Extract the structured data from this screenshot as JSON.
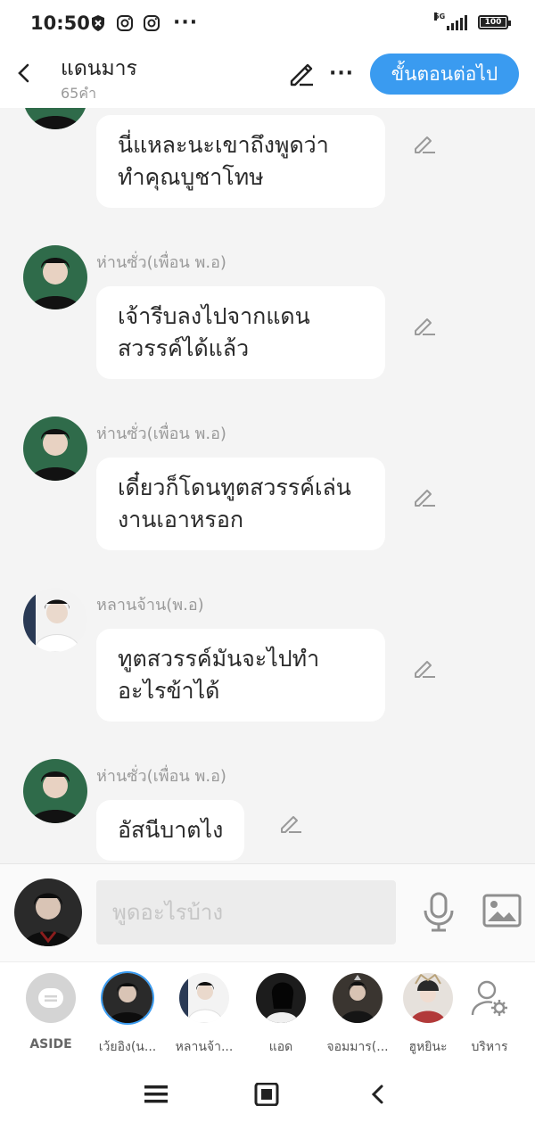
{
  "status_bar": {
    "time": "10:50",
    "network": "5G",
    "battery": "100"
  },
  "header": {
    "title": "แดนมาร",
    "word_count": "65คำ",
    "next_label": "ขั้นตอนต่อไป"
  },
  "messages": [
    {
      "speaker": "",
      "text": "นี่แหละนะเขาถึงพูดว่า\nทำคุณบูชาโทษ",
      "avatar": "dark-haired-man-green"
    },
    {
      "speaker": "ห่านซั่ว(เพื่อน พ.อ)",
      "text": "เจ้ารีบลงไปจากแดน\nสวรรค์ได้แล้ว",
      "avatar": "dark-haired-man-green"
    },
    {
      "speaker": "ห่านซั่ว(เพื่อน พ.อ)",
      "text": "เดี๋ยวก็โดนทูตสวรรค์เล่น\nงานเอาหรอก",
      "avatar": "dark-haired-man-green"
    },
    {
      "speaker": "หลานจ้าน(พ.อ)",
      "text": "ทูตสวรรค์มันจะไปทำ\nอะไรข้าได้",
      "avatar": "man-white-robes"
    },
    {
      "speaker": "ห่านซั่ว(เพื่อน พ.อ)",
      "text": "อัสนีบาตไง",
      "avatar": "dark-haired-man-green"
    }
  ],
  "composer": {
    "placeholder": "พูดอะไรบ้าง"
  },
  "characters": [
    {
      "name": "ASIDE",
      "icon": "aside-icon"
    },
    {
      "name": "เว้ยอิง(น...",
      "icon": "avatar"
    },
    {
      "name": "หลานจ้า...",
      "icon": "avatar"
    },
    {
      "name": "แอด",
      "icon": "avatar"
    },
    {
      "name": "จอมมาร(...",
      "icon": "avatar"
    },
    {
      "name": "ฮูหยินะ",
      "icon": "avatar"
    },
    {
      "name": "บริหาร",
      "icon": "user-gear-icon"
    }
  ],
  "colors": {
    "accent": "#3a9bf0",
    "bubble": "#ffffff",
    "background": "#f4f4f4"
  }
}
